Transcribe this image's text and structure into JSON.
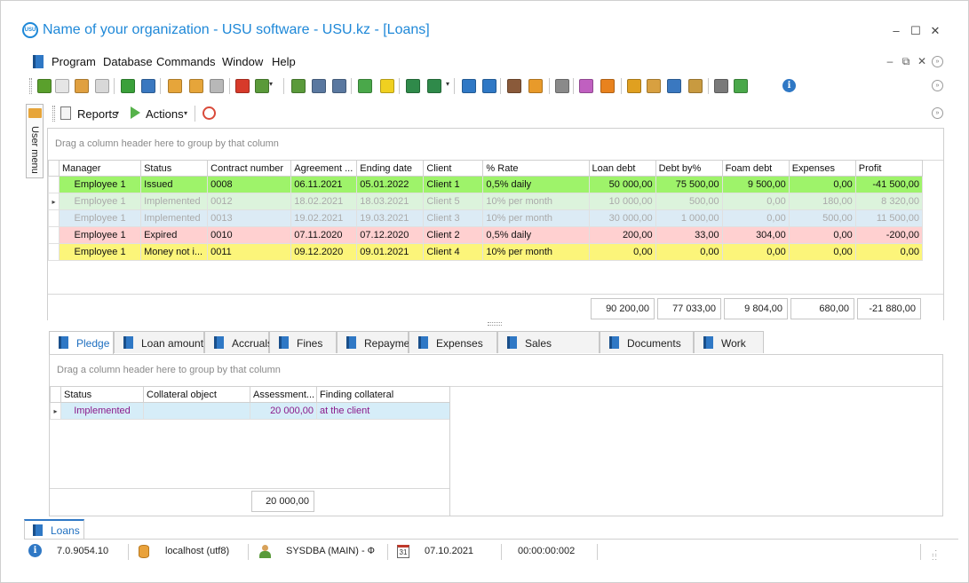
{
  "window": {
    "logo": "USU",
    "title": "Name of your organization - USU software - USU.kz - [Loans]",
    "controls": [
      "–",
      "☐",
      "✕"
    ]
  },
  "menubar": {
    "items": [
      "Program",
      "Database",
      "Commands",
      "Window",
      "Help"
    ],
    "mdi_controls": [
      "–",
      "⧉",
      "✕"
    ]
  },
  "toolbar": {
    "icons": [
      {
        "name": "add-row-icon",
        "color": "#5aa02c"
      },
      {
        "name": "copy-icon",
        "color": "#e5e5e5"
      },
      {
        "name": "edit-icon",
        "color": "#e0a040"
      },
      {
        "name": "delete-icon",
        "color": "#d8d8d8"
      },
      {
        "name": "refresh-icon",
        "color": "#3aa03a"
      },
      {
        "name": "search-icon",
        "color": "#3a78c0"
      },
      {
        "name": "filter-icon",
        "color": "#e6a53a"
      },
      {
        "name": "filter-clear-icon",
        "color": "#e6a53a"
      },
      {
        "name": "filter-check-icon",
        "color": "#b8b8b8"
      },
      {
        "name": "flag-icon",
        "color": "#d73a2a"
      },
      {
        "name": "picture-icon",
        "color": "#5a9a3a"
      },
      {
        "name": "columns-icon",
        "color": "#5a9a3a"
      },
      {
        "name": "expand-icon",
        "color": "#5a78a0"
      },
      {
        "name": "collapse-icon",
        "color": "#5a78a0"
      },
      {
        "name": "add-green-icon",
        "color": "#4aa84a"
      },
      {
        "name": "note-icon",
        "color": "#f0d020"
      },
      {
        "name": "export-excel-icon",
        "color": "#2f8a4a"
      },
      {
        "name": "import-icon",
        "color": "#2f8a4a"
      },
      {
        "name": "new-window-icon",
        "color": "#2f78c5"
      },
      {
        "name": "open-window-icon",
        "color": "#2f78c5"
      },
      {
        "name": "exit-icon",
        "color": "#8a5a3a"
      },
      {
        "name": "location-pin-icon",
        "color": "#e89a2a"
      },
      {
        "name": "settings-gear-icon",
        "color": "#8a8a8a"
      },
      {
        "name": "color-wheel-icon",
        "color": "#c060c0"
      },
      {
        "name": "rss-icon",
        "color": "#e8821e"
      },
      {
        "name": "lock-icon",
        "color": "#e0a020"
      },
      {
        "name": "users-icon",
        "color": "#d8a040"
      },
      {
        "name": "pin-tool-icon",
        "color": "#3a78c0"
      },
      {
        "name": "table-icon",
        "color": "#c89a40"
      },
      {
        "name": "print-icon",
        "color": "#7a7a7a"
      },
      {
        "name": "play-icon",
        "color": "#4aa84a"
      }
    ],
    "info_symbol": "i"
  },
  "toolbar2": {
    "reports_label": "Reports",
    "actions_label": "Actions"
  },
  "user_menu": {
    "label": "User menu"
  },
  "main_grid": {
    "group_hint": "Drag a column header here to group by that column",
    "columns": [
      "Manager",
      "Status",
      "Contract number",
      "Agreement ...",
      "Ending date",
      "Client",
      "% Rate",
      "Loan debt",
      "Debt by%",
      "Foam debt",
      "Expenses",
      "Profit"
    ],
    "rows": [
      {
        "style": "green",
        "cells": [
          "Employee 1",
          "Issued",
          "0008",
          "06.11.2021",
          "05.01.2022",
          "Client 1",
          "0,5% daily",
          "50 000,00",
          "75 500,00",
          "9 500,00",
          "0,00",
          "-41 500,00"
        ]
      },
      {
        "style": "gray",
        "cells": [
          "Employee 1",
          "Implemented",
          "0012",
          "18.02.2021",
          "18.03.2021",
          "Client 5",
          "10% per month",
          "10 000,00",
          "500,00",
          "0,00",
          "180,00",
          "8 320,00"
        ]
      },
      {
        "style": "blue",
        "cells": [
          "Employee 1",
          "Implemented",
          "0013",
          "19.02.2021",
          "19.03.2021",
          "Client 3",
          "10% per month",
          "30 000,00",
          "1 000,00",
          "0,00",
          "500,00",
          "11 500,00"
        ]
      },
      {
        "style": "pink",
        "cells": [
          "Employee 1",
          "Expired",
          "0010",
          "07.11.2020",
          "07.12.2020",
          "Client 2",
          "0,5% daily",
          "200,00",
          "33,00",
          "304,00",
          "0,00",
          "-200,00"
        ]
      },
      {
        "style": "yellow",
        "cells": [
          "Employee 1",
          "Money not i...",
          "0011",
          "09.12.2020",
          "09.01.2021",
          "Client 4",
          "10% per month",
          "0,00",
          "0,00",
          "0,00",
          "0,00",
          "0,00"
        ]
      }
    ],
    "totals": [
      "90 200,00",
      "77 033,00",
      "9 804,00",
      "680,00",
      "-21 880,00"
    ]
  },
  "detail_tabs": [
    "Pledge",
    "Loan amount",
    "Accruals",
    "Fines",
    "Repayment",
    "Expenses",
    "Sales",
    "Documents",
    "Work"
  ],
  "detail_grid": {
    "group_hint": "Drag a column header here to group by that column",
    "columns": [
      "Status",
      "Collateral object",
      "Assessment...",
      "Finding collateral"
    ],
    "rows": [
      {
        "cells": [
          "Implemented",
          "",
          "20 000,00",
          "at the client"
        ]
      }
    ],
    "total": "20 000,00"
  },
  "bottom_tab": {
    "label": "Loans"
  },
  "statusbar": {
    "version": "7.0.9054.10",
    "server": "localhost (utf8)",
    "user": "SYSDBA (MAIN) - Ф",
    "calendar_day": "31",
    "date": "07.10.2021",
    "timer": "00:00:00:002"
  },
  "colors": {
    "accent": "#1e88d8",
    "row_green": "#9ef36a",
    "row_gray": "#dcf3dc",
    "row_blue": "#dcebf5",
    "row_pink": "#ffd0d0",
    "row_yellow": "#fcf57a",
    "detail_row": "#d6edf8",
    "detail_text": "#8a1a8a"
  }
}
